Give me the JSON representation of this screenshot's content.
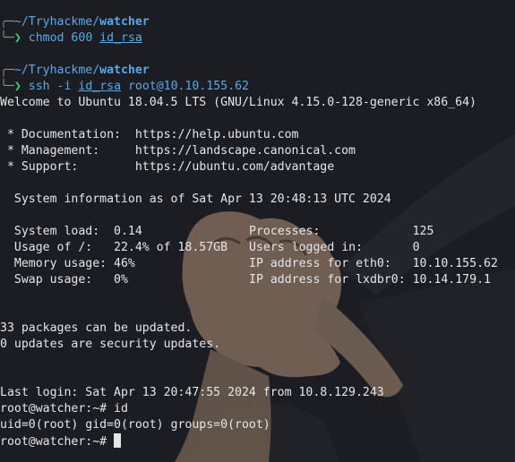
{
  "prompts": [
    {
      "path_prefix": "~/Tryhackme/",
      "path_dir": "watcher",
      "command": "chmod 600",
      "argument": "id_rsa",
      "tail": ""
    },
    {
      "path_prefix": "~/Tryhackme/",
      "path_dir": "watcher",
      "command": "ssh -i",
      "argument": "id_rsa",
      "tail": " root@10.10.155.62"
    }
  ],
  "output": {
    "welcome": "Welcome to Ubuntu 18.04.5 LTS (GNU/Linux 4.15.0-128-generic x86_64)",
    "links": [
      {
        "label": " * Documentation:  ",
        "url": "https://help.ubuntu.com"
      },
      {
        "label": " * Management:     ",
        "url": "https://landscape.canonical.com"
      },
      {
        "label": " * Support:        ",
        "url": "https://ubuntu.com/advantage"
      }
    ],
    "sysinfo_header": "  System information as of Sat Apr 13 20:48:13 UTC 2024",
    "stats_left": [
      "  System load:  0.14",
      "  Usage of /:   22.4% of 18.57GB",
      "  Memory usage: 46%",
      "  Swap usage:   0%"
    ],
    "stats_right": [
      "Processes:             125",
      "Users logged in:       0",
      "IP address for eth0:   10.10.155.62",
      "IP address for lxdbr0: 10.14.179.1"
    ],
    "updates_1": "33 packages can be updated.",
    "updates_2": "0 updates are security updates.",
    "last_login": "Last login: Sat Apr 13 20:47:55 2024 from 10.8.129.243",
    "root_prompt": "root@watcher:~# ",
    "root_cmd": "id",
    "id_output": "uid=0(root) gid=0(root) groups=0(root)"
  },
  "glyphs": {
    "prompt_corner_top": "╭─",
    "prompt_corner_bottom": "╰─",
    "prompt_arrow": "❯"
  },
  "colors": {
    "background": "#1b1d23",
    "text": "#e4e6ea",
    "path": "#5aa9e6",
    "arrow": "#3fd17a"
  }
}
